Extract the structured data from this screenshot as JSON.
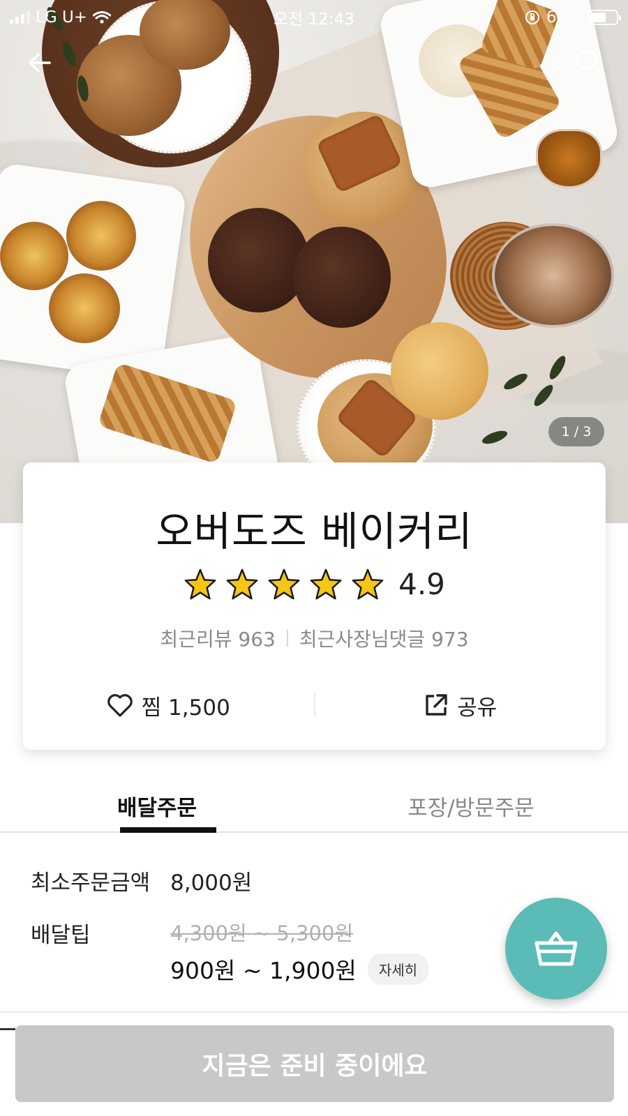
{
  "status_bar": {
    "carrier": "LG U+",
    "time": "오전 12:43",
    "battery_percent": "61%",
    "battery_level": 0.61
  },
  "hero": {
    "photo_description_icon": "bakery-photo",
    "page_indicator": "1 / 3"
  },
  "store": {
    "name": "오버도즈 베이커리",
    "rating": "4.9",
    "rating_stars": 5,
    "recent_reviews": "최근리뷰 963",
    "owner_comments": "최근사장님댓글 973",
    "like_label": "찜 1,500",
    "share_label": "공유"
  },
  "tabs": [
    {
      "label": "배달주문",
      "active": true
    },
    {
      "label": "포장/방문주문",
      "active": false
    }
  ],
  "order_info": {
    "min_order_label": "최소주문금액",
    "min_order_value": "8,000원",
    "delivery_tip_label": "배달팁",
    "delivery_tip_original": "4,300원 ~ 5,300원",
    "delivery_tip_discounted": "900원 ~ 1,900원",
    "detail_button": "자세히"
  },
  "bottom_button": "지금은 준비 중이에요",
  "colors": {
    "cart_fab": "#5bbcb7",
    "star": "#f5c518",
    "disabled_button": "#c8c8c8"
  }
}
